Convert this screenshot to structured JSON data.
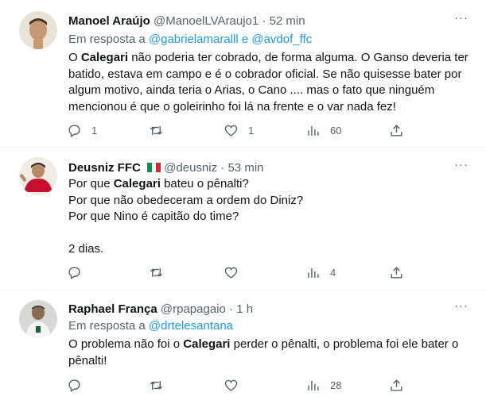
{
  "tweets": [
    {
      "name": "Manoel Araújo",
      "handle": "@ManoelLVAraujo1",
      "sep": "·",
      "time": "52 min",
      "reply_prefix": "Em resposta a",
      "reply_link1": "@gabrielamaralll",
      "reply_and": "e",
      "reply_link2": "@avdof_ffc",
      "lines": [
        [
          "O ",
          "Calegari",
          " não poderia ter cobrado, de forma alguma. O Ganso deveria ter"
        ],
        "batido, estava em campo e é o cobrador oficial. Se não quisesse bater por",
        "algum motivo, ainda teria o Arias, o Cano .... mas o fato que ninguém",
        "mencionou é que o goleirinho foi lá na frente e o var nada fez!"
      ],
      "replies": "1",
      "retweets": "",
      "likes": "1",
      "views": "60"
    },
    {
      "name": "Deusniz FFC",
      "handle": "@deusniz",
      "sep": "·",
      "time": "53 min",
      "lines": [
        [
          "Por que ",
          "Calegari",
          " bateu o pênalti?"
        ],
        "Por que não obedeceram a ordem do Diniz?",
        "Por que Nino é capitão do time?",
        "",
        "2 dias."
      ],
      "replies": "",
      "retweets": "",
      "likes": "",
      "views": "4"
    },
    {
      "name": "Raphael França",
      "handle": "@rpapagaio",
      "sep": "·",
      "time": "1 h",
      "reply_prefix": "Em resposta a",
      "reply_link1": "@drtelesantana",
      "lines": [
        [
          "O problema não foi o ",
          "Calegari",
          " perder o pênalti, o problema foi ele bater o"
        ],
        "pênalti!"
      ],
      "replies": "",
      "retweets": "",
      "likes": "",
      "views": "28"
    }
  ],
  "more_glyph": "···",
  "colors": {
    "link": "#1d9bf0",
    "muted": "#536471",
    "text": "#0f1419"
  }
}
